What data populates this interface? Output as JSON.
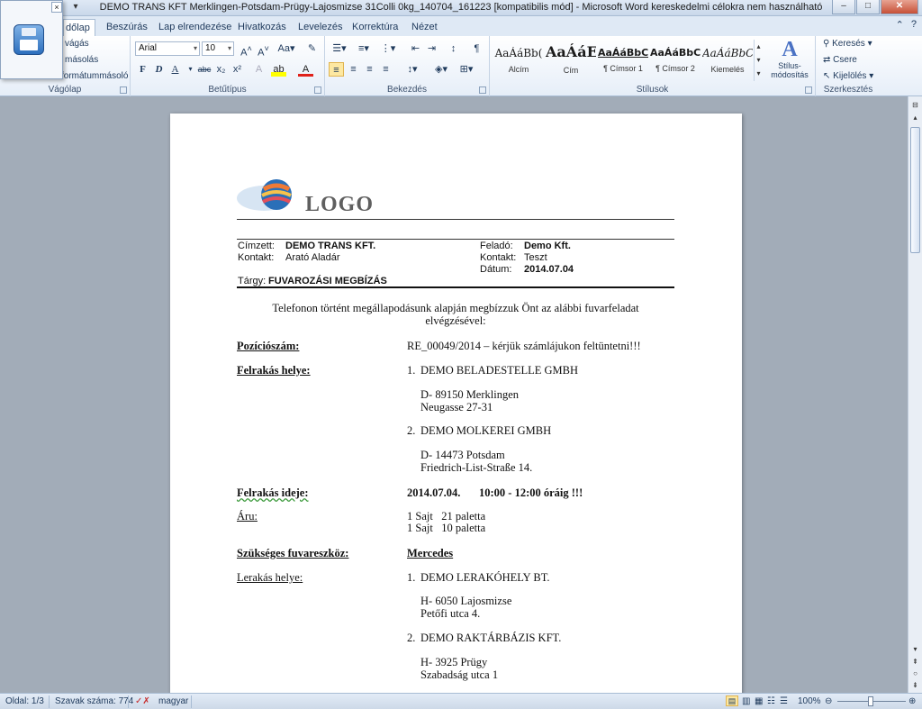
{
  "window": {
    "title": "DEMO TRANS KFT Merklingen-Potsdam-Prügy-Lajosmizse 31Colli 0kg_140704_161223 [kompatibilis mód] - Microsoft Word kereskedelmi célokra nem használható",
    "minimize": "–",
    "maximize": "□",
    "close": "✕"
  },
  "ribbon_tabs": [
    "Kezdőlap",
    "Beszúrás",
    "Lap elrendezése",
    "Hivatkozás",
    "Levelezés",
    "Korrektúra",
    "Nézet"
  ],
  "ribbon_tab_visible_active": "dőlap",
  "clipboard": {
    "items": [
      "vágás",
      "másolás",
      "formátummásoló"
    ],
    "label": "Vágólap"
  },
  "font": {
    "name": "Arial",
    "size": "10",
    "label": "Betűtípus",
    "bold": "F",
    "italic": "D",
    "underline": "A"
  },
  "paragraph": {
    "label": "Bekezdés"
  },
  "styles": {
    "label": "Stílusok",
    "tiles": [
      {
        "sample": "AaÁáBb(",
        "name": "Alcím"
      },
      {
        "sample": "AaÁáE",
        "name": "Cím"
      },
      {
        "sample": "AaÁáBbC",
        "name": "¶ Címsor 1"
      },
      {
        "sample": "AaÁáBbC",
        "name": "¶ Címsor 2"
      },
      {
        "sample": "AaÁáBbC",
        "name": "Kiemelés"
      }
    ],
    "change_styles": "Stílus-\nmódosítás"
  },
  "editing": {
    "label": "Szerkesztés",
    "find": "Keresés",
    "replace": "Csere",
    "select": "Kijelölés"
  },
  "document": {
    "logo_text": "LOGO",
    "recipient_label": "Címzett:",
    "recipient": "DEMO TRANS KFT.",
    "contact_label": "Kontakt:",
    "contact": "Arató Aladár",
    "sender_label": "Feladó:",
    "sender": "Demo Kft.",
    "sender_contact_label": "Kontakt:",
    "sender_contact": "Teszt",
    "date_label": "Dátum:",
    "date": "2014.07.04",
    "subject_label": "Tárgy:",
    "subject": "FUVAROZÁSI MEGBÍZÁS",
    "intro_line1": "Telefonon történt megállapodásunk alapján megbízzuk Önt az alábbi fuvarfeladat",
    "intro_line2": "elvégzésével:",
    "position_label": "Pozíciószám:",
    "position_value": "RE_00049/2014 – kérjük számlájukon feltüntetni!!!",
    "loading_place_label": "Felrakás helye:",
    "loading": [
      {
        "num": "1.",
        "name": "DEMO BELADESTELLE GMBH",
        "line1": "D- 89150 Merklingen",
        "line2": "Neugasse 27-31"
      },
      {
        "num": "2.",
        "name": "DEMO MOLKEREI GMBH",
        "line1": "D- 14473 Potsdam",
        "line2": "Friedrich-List-Straße 14."
      }
    ],
    "loading_time_label": "Felrakás ideje:",
    "loading_time_date": "2014.07.04.",
    "loading_time_hours": "10:00 - 12:00 óráig !!!",
    "goods_label": "Áru:",
    "goods": [
      "1 Sajt   21 paletta",
      "1 Sajt   10 paletta"
    ],
    "vehicle_label": "Szükséges fuvareszköz:",
    "vehicle": "Mercedes",
    "unloading_place_label": "Lerakás helye:",
    "unloading": [
      {
        "num": "1.",
        "name": "DEMO LERAKÓHELY BT.",
        "line1": "H- 6050 Lajosmizse",
        "line2": "Petőfi utca 4."
      },
      {
        "num": "2.",
        "name": "DEMO RAKTÁRBÁZIS KFT.",
        "line1": "H- 3925 Prügy",
        "line2": "Szabadság utca 1"
      }
    ]
  },
  "status": {
    "page": "Oldal: 1/3",
    "words": "Szavak száma: 774",
    "language": "magyar",
    "zoom": "100%"
  }
}
